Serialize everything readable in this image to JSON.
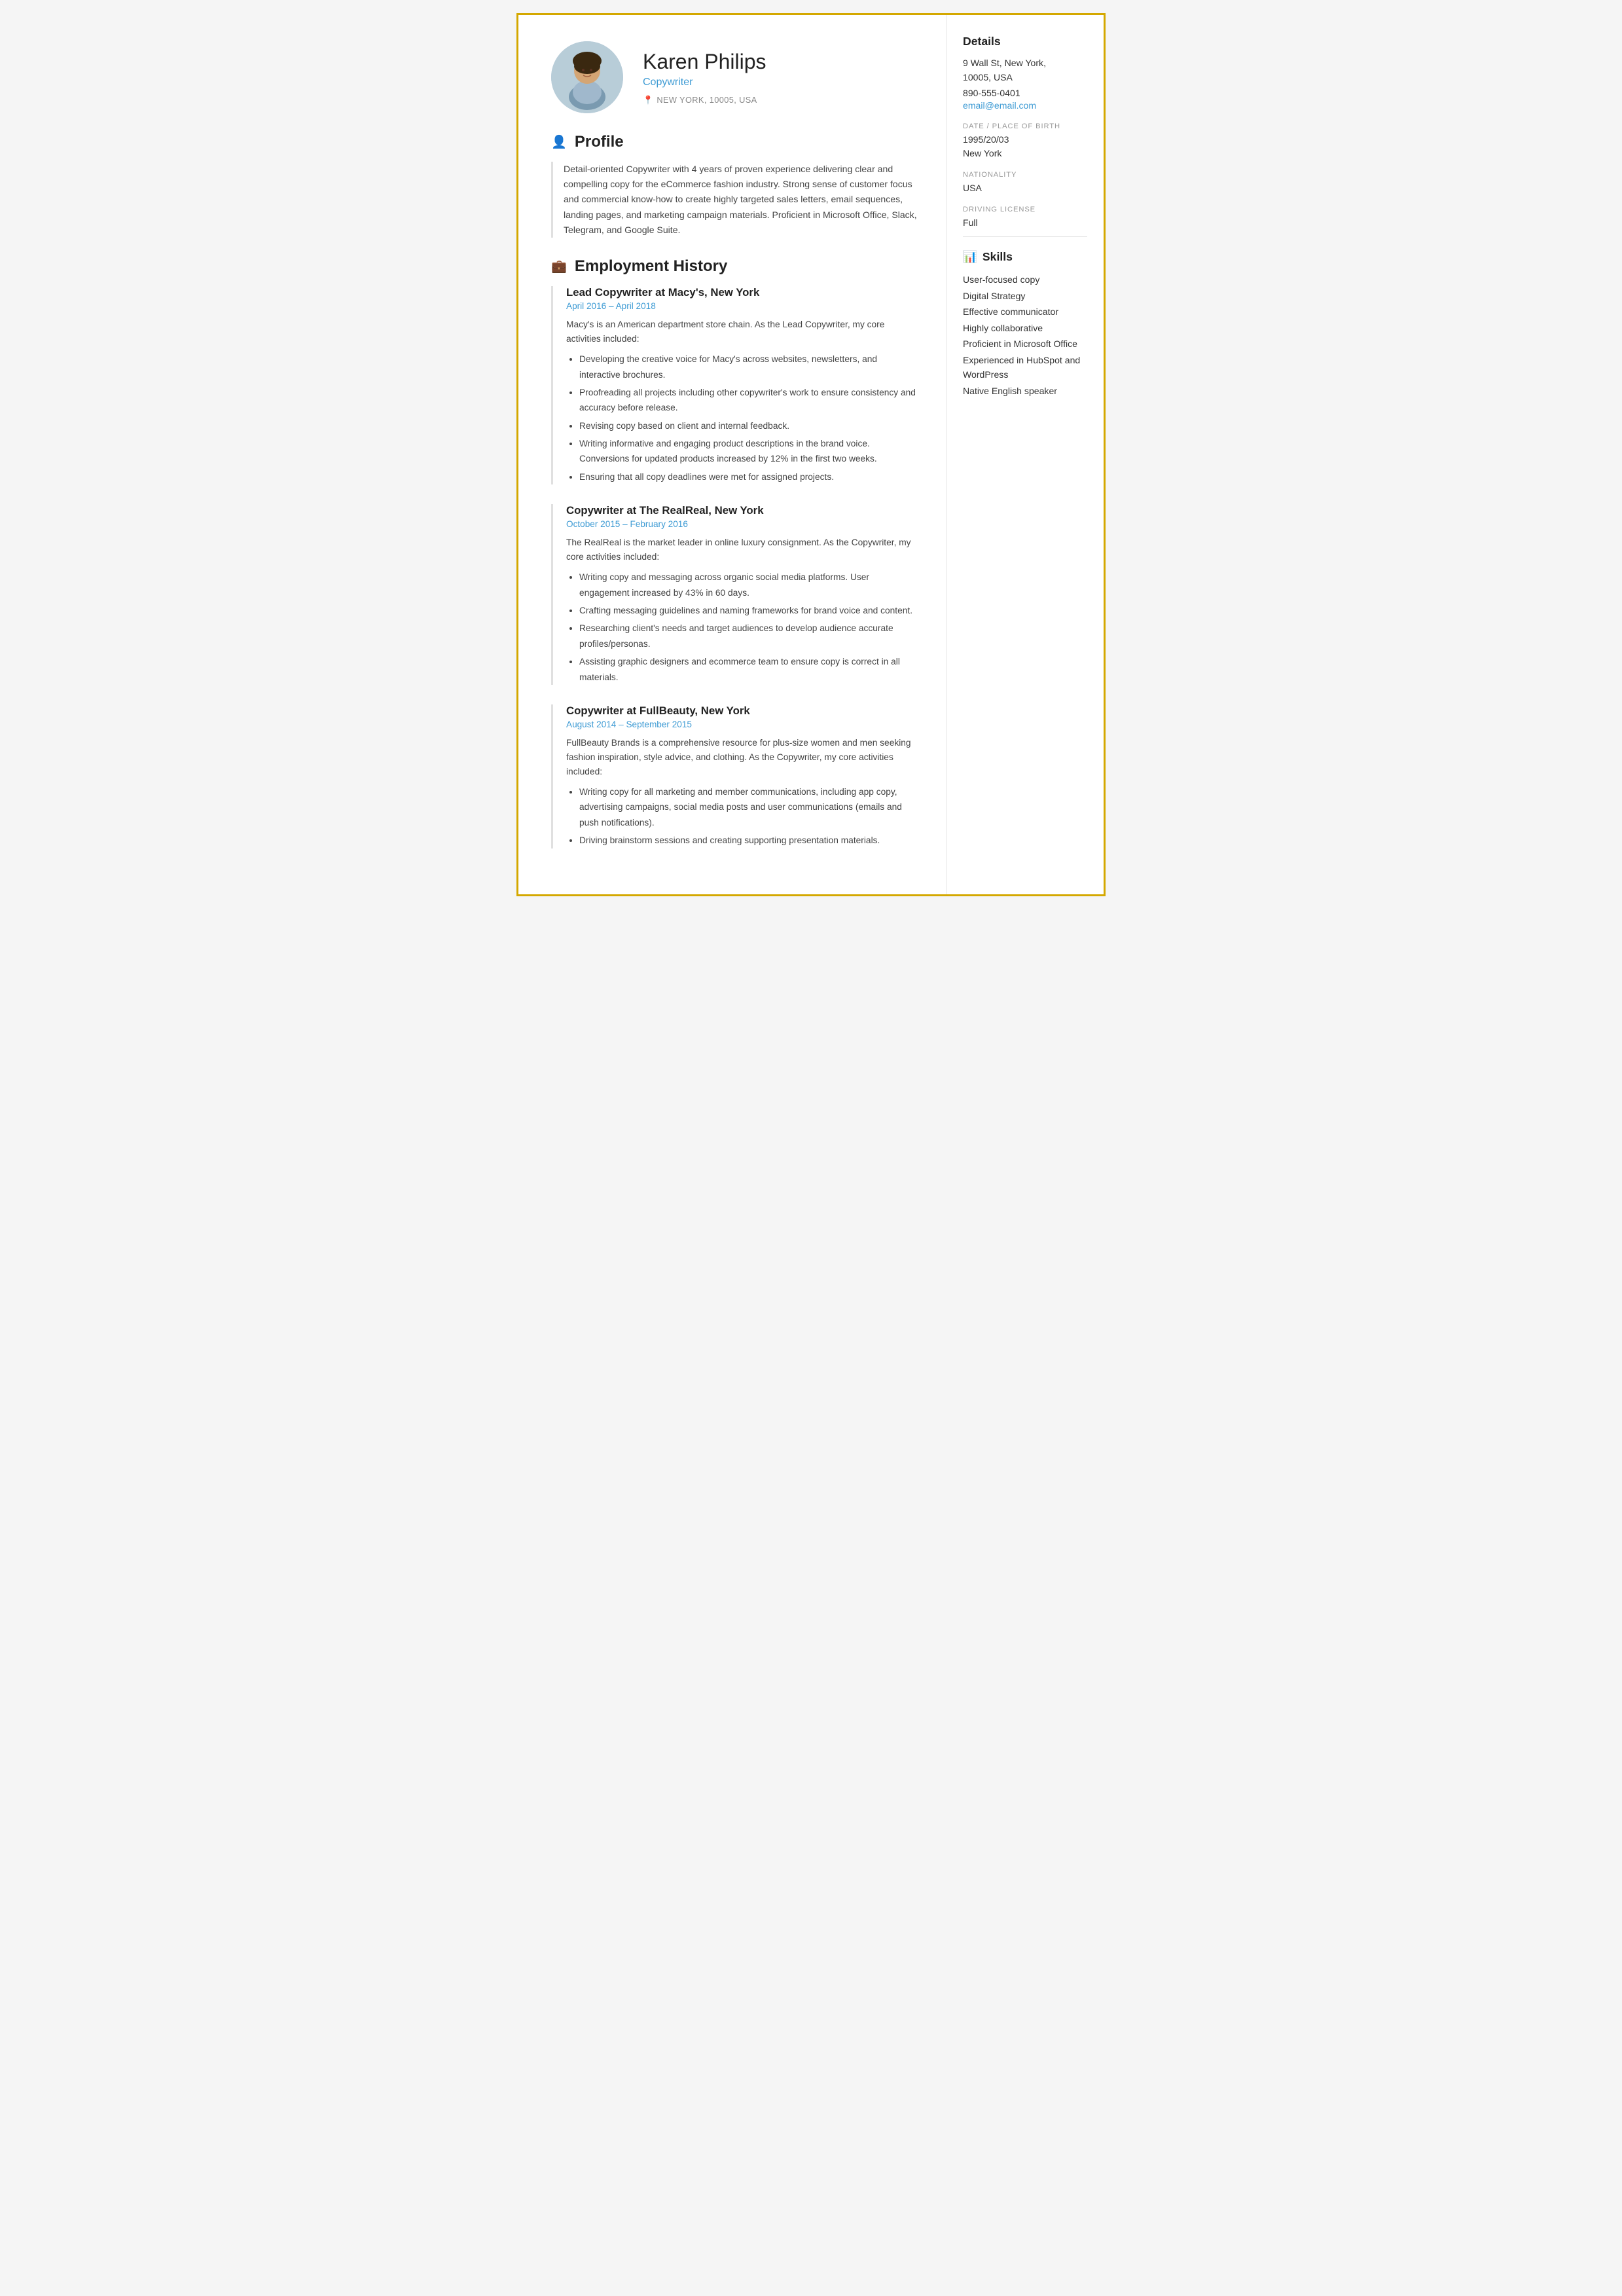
{
  "header": {
    "name": "Karen Philips",
    "job_title": "Copywriter",
    "location": "NEW YORK, 10005, USA"
  },
  "profile": {
    "section_label": "Profile",
    "text": "Detail-oriented Copywriter with 4 years of proven experience delivering clear and compelling copy for the eCommerce fashion industry. Strong sense of customer focus and commercial know-how to create highly targeted sales letters, email sequences, landing pages, and marketing campaign materials. Proficient in Microsoft Office, Slack, Telegram, and Google Suite."
  },
  "employment": {
    "section_label": "Employment History",
    "entries": [
      {
        "title": "Lead Copywriter at Macy's, New York",
        "dates": "April 2016  –  April 2018",
        "description": "Macy's is an American department store chain. As the Lead Copywriter, my core activities included:",
        "bullets": [
          "Developing the creative voice for Macy's across websites, newsletters, and interactive brochures.",
          "Proofreading all projects including other copywriter's work to ensure consistency and accuracy before release.",
          "Revising copy based on client and internal feedback.",
          "Writing informative and engaging product descriptions in the brand voice. Conversions for updated products increased by 12% in the first two weeks.",
          "Ensuring that all copy deadlines were met for assigned projects."
        ]
      },
      {
        "title": "Copywriter at The RealReal, New York",
        "dates": "October 2015  –  February 2016",
        "description": "The RealReal is the market leader in online luxury consignment. As the Copywriter, my core activities included:",
        "bullets": [
          "Writing copy and messaging across organic social media platforms. User engagement increased by 43% in 60 days.",
          "Crafting messaging guidelines and naming frameworks for brand voice and content.",
          "Researching client's needs and target audiences to develop audience accurate profiles/personas.",
          "Assisting graphic designers and ecommerce team to ensure copy is correct in all materials."
        ]
      },
      {
        "title": "Copywriter at FullBeauty, New York",
        "dates": "August 2014  –  September 2015",
        "description": "FullBeauty Brands is a comprehensive resource for plus-size women and men seeking fashion inspiration, style advice, and clothing. As the Copywriter, my core activities included:",
        "bullets": [
          "Writing copy for all marketing and member communications, including app copy, advertising campaigns, social media posts and user communications (emails and push notifications).",
          "Driving brainstorm sessions and creating supporting presentation materials."
        ]
      }
    ]
  },
  "sidebar": {
    "details_label": "Details",
    "address": "9 Wall St, New York,\n10005, USA",
    "phone": "890-555-0401",
    "email": "email@email.com",
    "dob_label": "DATE / PLACE OF BIRTH",
    "dob": "1995/20/03",
    "birthplace": "New York",
    "nationality_label": "NATIONALITY",
    "nationality": "USA",
    "driving_label": "DRIVING LICENSE",
    "driving": "Full",
    "skills_label": "Skills",
    "skills": [
      "User-focused copy",
      "Digital Strategy",
      "Effective communicator",
      "Highly collaborative",
      "Proficient in Microsoft Office",
      "Experienced in HubSpot and WordPress",
      "Native English speaker"
    ]
  }
}
